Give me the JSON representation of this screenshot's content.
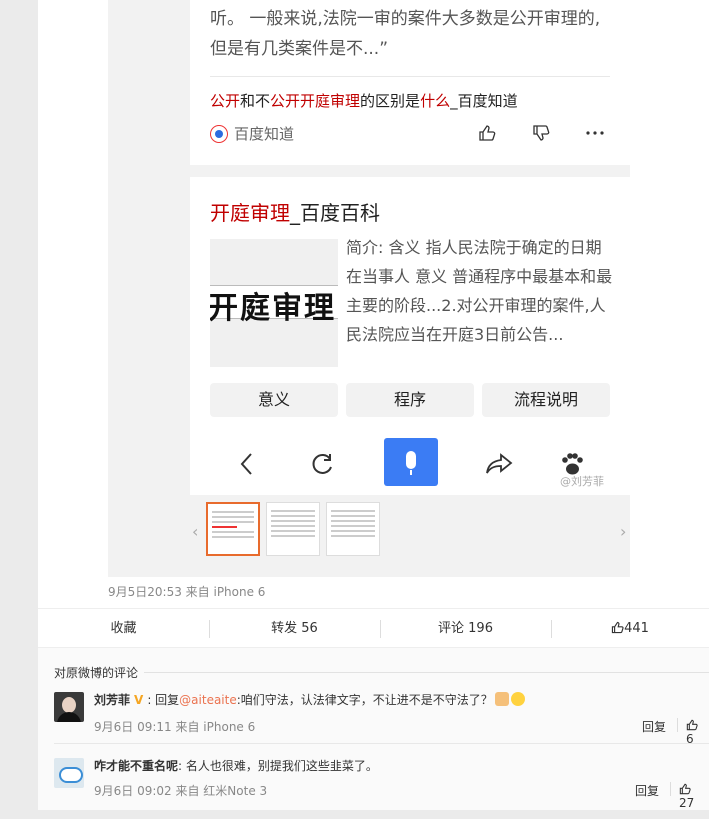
{
  "result1": {
    "snippet": "听。 一般来说,法院一审的案件大多数是公开审理的,但是有几类案件是不...”",
    "title_parts": [
      "公开",
      "和不",
      "公开开庭审理",
      "的区别是",
      "什么",
      "_百度知道"
    ],
    "source": "百度知道"
  },
  "result2": {
    "title_hl": "开庭审理",
    "title_rest": "_百度百科",
    "image_text": "开庭审理",
    "desc": "简介: 含义 指人民法院于确定的日期在当事人 意义 普通程序中最基本和最主要的阶段...2.对公开审理的案件,人民法院应当在开庭3日前公告...",
    "buttons": [
      "意义",
      "程序",
      "流程说明"
    ]
  },
  "watermark": "@刘芳菲",
  "post_meta": "9月5日20:53 来自 iPhone 6",
  "actions": {
    "favorite": "收藏",
    "repost": "转发 56",
    "comment": "评论 196",
    "like": "441"
  },
  "comments_title": "对原微博的评论",
  "comments": [
    {
      "name": "刘芳菲",
      "prefix": ": 回复",
      "mention": "@aiteaite",
      "text": ":咱们守法，认法律文字，不让进不是不守法了？",
      "meta": "9月6日 09:11 来自 iPhone 6",
      "reply": "回复",
      "likes": "6"
    },
    {
      "name": "咋才能不重名呢",
      "text": ": 名人也很难，别提我们这些韭菜了。",
      "meta": "9月6日 09:02 来自 红米Note 3",
      "reply": "回复",
      "likes": "27"
    }
  ],
  "colors": {
    "highlight": "#c00000",
    "accent_orange": "#eb7350",
    "mic_blue": "#3b7cf4"
  }
}
